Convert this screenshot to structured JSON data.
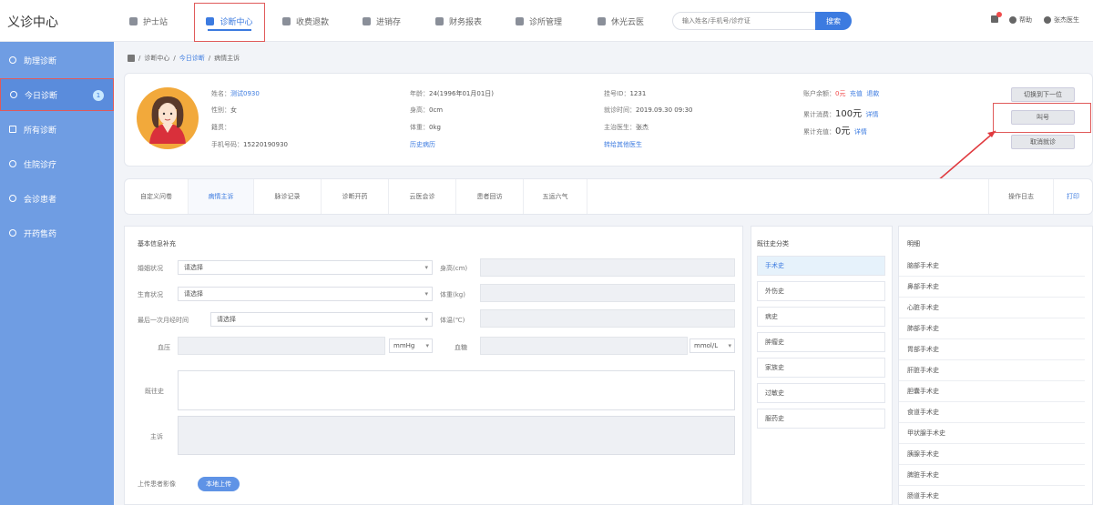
{
  "app": {
    "title": "义诊中心"
  },
  "nav": {
    "items": [
      {
        "label": "护士站"
      },
      {
        "label": "诊断中心"
      },
      {
        "label": "收费退款"
      },
      {
        "label": "进销存"
      },
      {
        "label": "财务报表"
      },
      {
        "label": "诊所管理"
      },
      {
        "label": "休光云医"
      }
    ],
    "search_placeholder": "输入姓名/手机号/诊疗证",
    "search_button": "搜索",
    "help": "帮助",
    "user": "张杰医生",
    "colors": {
      "accent": "#3c7be0",
      "sidebar": "#6f9de3",
      "highlight": "#e05a5a"
    }
  },
  "sidebar": {
    "items": [
      {
        "label": "助理诊断"
      },
      {
        "label": "今日诊断",
        "badge": "1"
      },
      {
        "label": "所有诊断"
      },
      {
        "label": "住院诊疗"
      },
      {
        "label": "会诊患者"
      },
      {
        "label": "开药售药"
      }
    ]
  },
  "breadcrumb": {
    "items": [
      "诊断中心",
      "今日诊断",
      "病情主诉"
    ]
  },
  "patient": {
    "name_label": "姓名：",
    "name": "测试0930",
    "gender_label": "性别：",
    "gender": "女",
    "origin_label": "籍贯：",
    "phone_label": "手机号码：",
    "phone": "15220190930",
    "age_label": "年龄：",
    "age": "24(1996年01月01日)",
    "height_label": "身高：",
    "height": "0cm",
    "weight_label": "体重：",
    "weight": "0kg",
    "history_link": "历史病历",
    "reg_label": "挂号ID：",
    "reg_id": "1231",
    "visit_time_label": "就诊时间：",
    "visit_time": "2019.09.30 09:30",
    "doctor_label": "主治医生：",
    "doctor": "张杰",
    "transfer_link": "转给其他医生",
    "balance_label": "账户余额：",
    "balance": "0元",
    "recharge": "充值",
    "refund": "退款",
    "consume_label": "累计消费：",
    "consume": "100元",
    "consume_detail": "详情",
    "topup_label": "累计充值：",
    "topup": "0元",
    "topup_detail": "详情",
    "btn_next": "切换到下一位",
    "btn_call": "叫号",
    "btn_cancel": "取消就诊"
  },
  "tabs": {
    "items": [
      "自定义问卷",
      "病情主诉",
      "脉诊记录",
      "诊断开药",
      "云医会诊",
      "患者回访",
      "五运六气"
    ],
    "log": "操作日志",
    "print": "打印"
  },
  "form": {
    "section_title": "基本信息补充",
    "marital_label": "婚姻状况",
    "marital_value": "请选择",
    "fertility_label": "生育状况",
    "fertility_value": "请选择",
    "menses_label": "最后一次月经时间",
    "menses_value": "请选择",
    "height_label": "身高(cm)",
    "weight_label": "体重(kg)",
    "temp_label": "体温(℃)",
    "bp_label": "血压",
    "bp_unit": "mmHg",
    "sugar_label": "血糖",
    "sugar_unit": "mmol/L",
    "past_label": "既往史",
    "chief_label": "主诉",
    "upload_label": "上传患者影像",
    "upload_button": "本地上传"
  },
  "history": {
    "category_title": "既往史分类",
    "categories": [
      "手术史",
      "外伤史",
      "病史",
      "肿瘤史",
      "家族史",
      "过敏史",
      "服药史"
    ],
    "detail_title": "明细",
    "details": [
      "脑部手术史",
      "鼻部手术史",
      "心脏手术史",
      "肺部手术史",
      "胃部手术史",
      "肝脏手术史",
      "胆囊手术史",
      "食道手术史",
      "甲状腺手术史",
      "胰腺手术史",
      "脾脏手术史",
      "肠道手术史"
    ]
  }
}
